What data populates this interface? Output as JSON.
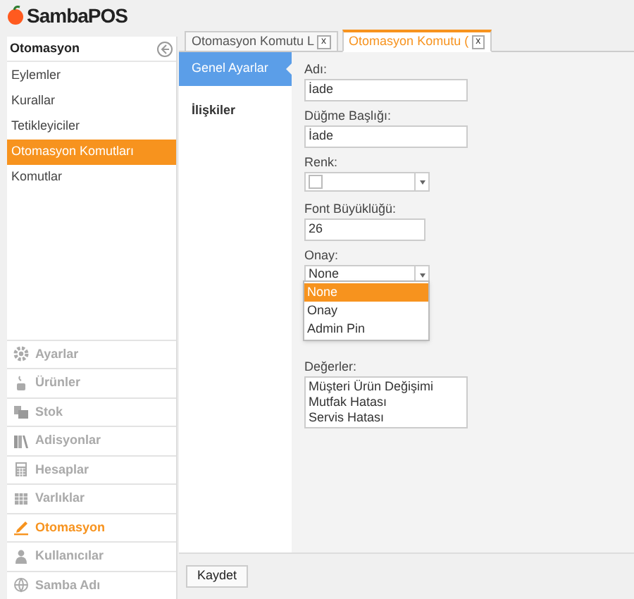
{
  "app": {
    "logo": "SambaPOS"
  },
  "sidebar": {
    "title": "Otomasyon",
    "items": [
      {
        "label": "Eylemler",
        "selected": false
      },
      {
        "label": "Kurallar",
        "selected": false
      },
      {
        "label": "Tetikleyiciler",
        "selected": false
      },
      {
        "label": "Otomasyon Komutları",
        "selected": true
      },
      {
        "label": "Komutlar",
        "selected": false
      }
    ]
  },
  "navigation": [
    {
      "label": "Ayarlar",
      "kind": "gear",
      "selected": false
    },
    {
      "label": "Ürünler",
      "kind": "cup",
      "selected": false
    },
    {
      "label": "Stok",
      "kind": "stock",
      "selected": false
    },
    {
      "label": "Adisyonlar",
      "kind": "books",
      "selected": false
    },
    {
      "label": "Hesaplar",
      "kind": "calculator",
      "selected": false
    },
    {
      "label": "Varlıklar",
      "kind": "grid",
      "selected": false
    },
    {
      "label": "Otomasyon",
      "kind": "pen",
      "selected": true
    },
    {
      "label": "Kullanıcılar",
      "kind": "person",
      "selected": false
    },
    {
      "label": "Samba Adı",
      "kind": "globe",
      "selected": false
    }
  ],
  "tabs": [
    {
      "label": "Otomasyon Komutu L",
      "close": "x",
      "selected": false
    },
    {
      "label": "Otomasyon Komutu (",
      "close": "x",
      "selected": true
    }
  ],
  "sections": [
    {
      "label": "Genel Ayarlar",
      "selected": true
    },
    {
      "label": "İlişkiler",
      "selected": false
    }
  ],
  "form": {
    "name_label": "Adı:",
    "name_value": "İade",
    "caption_label": "Düğme Başlığı:",
    "caption_value": "İade",
    "color_label": "Renk:",
    "font_size_label": "Font Büyüklüğü:",
    "font_size_value": "26",
    "confirmation_label": "Onay:",
    "confirmation_value": "None",
    "confirmation_options": [
      {
        "label": "None",
        "selected": true
      },
      {
        "label": "Onay",
        "selected": false
      },
      {
        "label": "Admin Pin",
        "selected": false
      }
    ],
    "values_label": "Değerler:",
    "values": [
      "Müşteri Ürün Değişimi",
      "Mutfak Hatası",
      "Servis Hatası"
    ]
  },
  "buttons": [
    "Kaydet"
  ]
}
